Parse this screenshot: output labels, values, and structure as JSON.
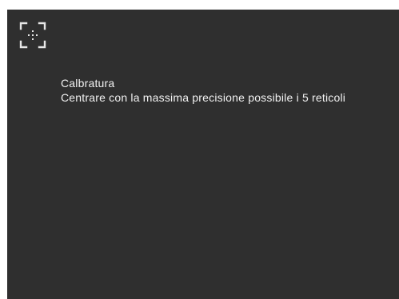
{
  "screen": {
    "icon": "calibration-crosshair-icon",
    "title": "Calbratura",
    "instructions": "Centrare con la massima precisione possibile i 5 reticoli"
  },
  "colors": {
    "background": "#2f2f2f",
    "text": "#f2f2f2",
    "icon": "#e6e6e6"
  }
}
